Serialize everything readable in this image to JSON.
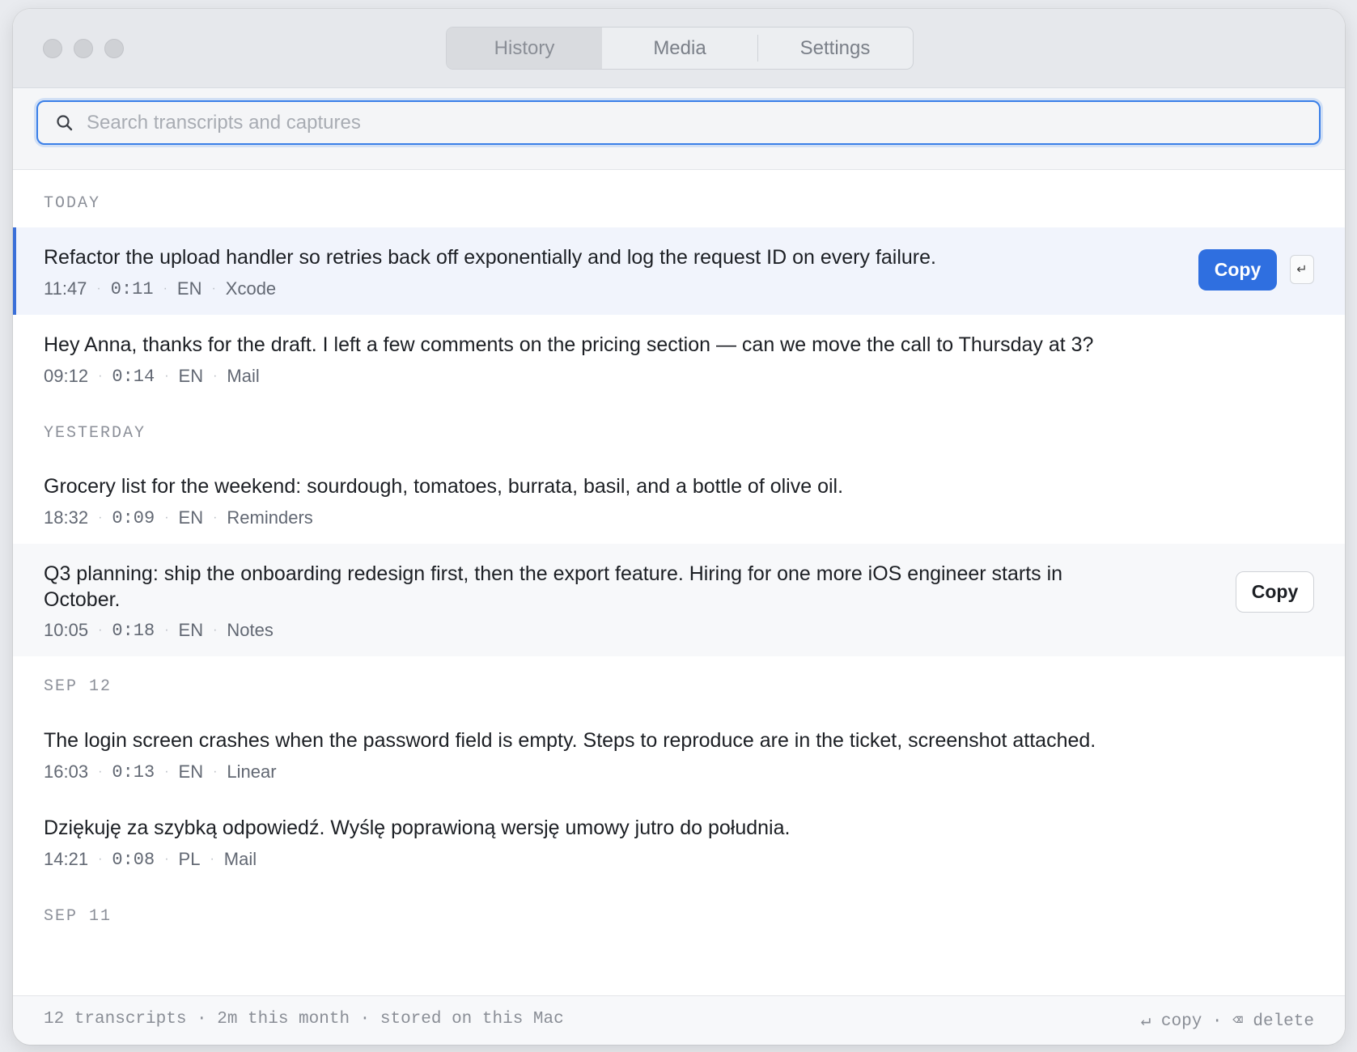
{
  "tabs": [
    {
      "label": "History",
      "active": true
    },
    {
      "label": "Media",
      "active": false
    },
    {
      "label": "Settings",
      "active": false
    }
  ],
  "search": {
    "placeholder": "Search transcripts and captures",
    "value": ""
  },
  "sections": [
    {
      "heading": "TODAY",
      "items": [
        {
          "text": "Refactor the upload handler so retries back off exponentially and log the request ID on every failure.",
          "time": "11:47",
          "duration": "0:11",
          "lang": "EN",
          "app": "Xcode"
        },
        {
          "text": "Hey Anna, thanks for the draft. I left a few comments on the pricing section — can we move the call to Thursday at 3?",
          "time": "09:12",
          "duration": "0:14",
          "lang": "EN",
          "app": "Mail"
        }
      ]
    },
    {
      "heading": "YESTERDAY",
      "items": [
        {
          "text": "Grocery list for the weekend: sourdough, tomatoes, burrata, basil, and a bottle of olive oil.",
          "time": "18:32",
          "duration": "0:09",
          "lang": "EN",
          "app": "Reminders"
        },
        {
          "text": "Q3 planning: ship the onboarding redesign first, then the export feature. Hiring for one more iOS engineer starts in October.",
          "time": "10:05",
          "duration": "0:18",
          "lang": "EN",
          "app": "Notes"
        }
      ]
    },
    {
      "heading": "SEP 12",
      "items": [
        {
          "text": "The login screen crashes when the password field is empty. Steps to reproduce are in the ticket, screenshot attached.",
          "time": "16:03",
          "duration": "0:13",
          "lang": "EN",
          "app": "Linear"
        },
        {
          "text": "Dziękuję za szybką odpowiedź. Wyślę poprawioną wersję umowy jutro do południa.",
          "time": "14:21",
          "duration": "0:08",
          "lang": "PL",
          "app": "Mail"
        }
      ]
    },
    {
      "heading": "SEP 11",
      "items": []
    }
  ],
  "actions": {
    "copy_label": "Copy",
    "return_key": "↵"
  },
  "footer": {
    "summary": "12 transcripts · 2m this month · stored on this Mac",
    "hints": "↵ copy · ⌫ delete"
  }
}
